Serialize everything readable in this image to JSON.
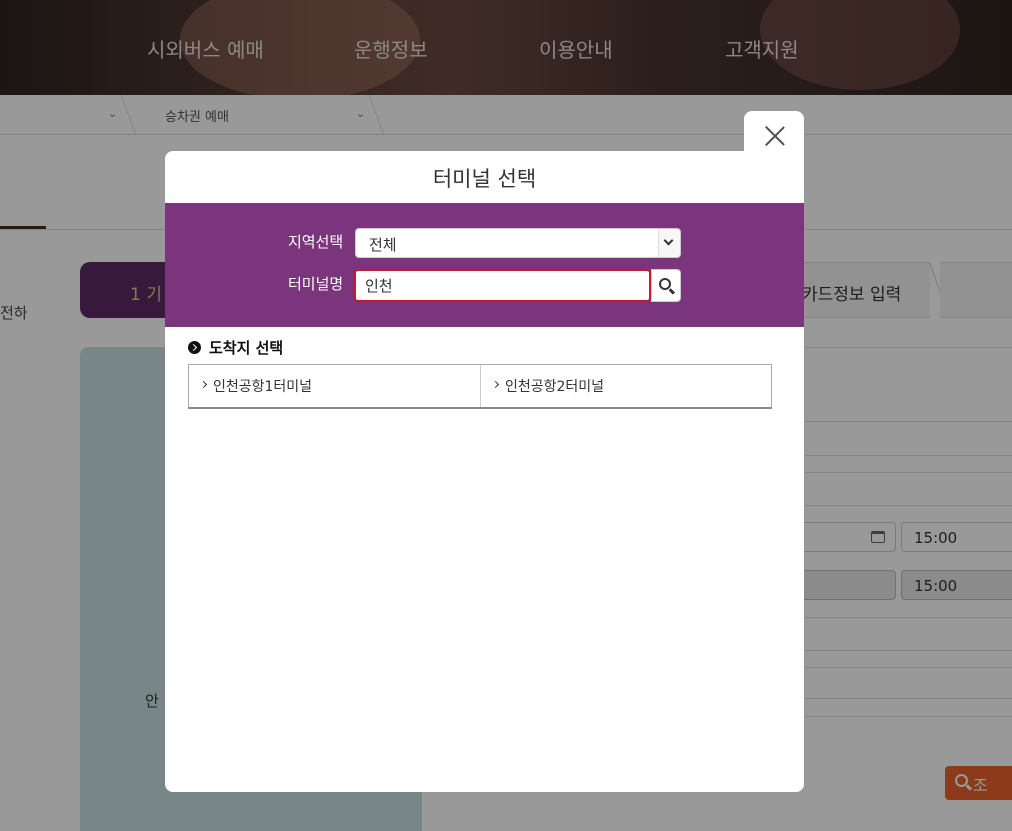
{
  "nav": {
    "items": [
      "시외버스 예매",
      "운행정보",
      "이용안내",
      "고객지원"
    ]
  },
  "breadcrumb": {
    "current": "승차권 예매"
  },
  "background": {
    "side_text": "전하",
    "step1_number": "1",
    "step1_label": "기",
    "step3_label": "카드정보 입력",
    "left_panel_text": "안",
    "time1": "15:00",
    "time2": "15:00",
    "search_label": "조"
  },
  "modal": {
    "title": "터미널 선택",
    "region_label": "지역선택",
    "region_value": "전체",
    "name_label": "터미널명",
    "name_value": "인천",
    "section_title": "도착지 선택",
    "results": [
      "인천공항1터미널",
      "인천공항2터미널"
    ]
  },
  "icons": {
    "close": "close-icon",
    "search": "search-icon",
    "dropdown": "chevron-down-icon",
    "bullet": "circle-arrow-icon",
    "calendar": "calendar-icon"
  },
  "colors": {
    "filter_bg": "#7a357c",
    "input_focus_border": "#c01c2d",
    "search_button": "#e8632a",
    "step_active": "#5c2a66"
  }
}
